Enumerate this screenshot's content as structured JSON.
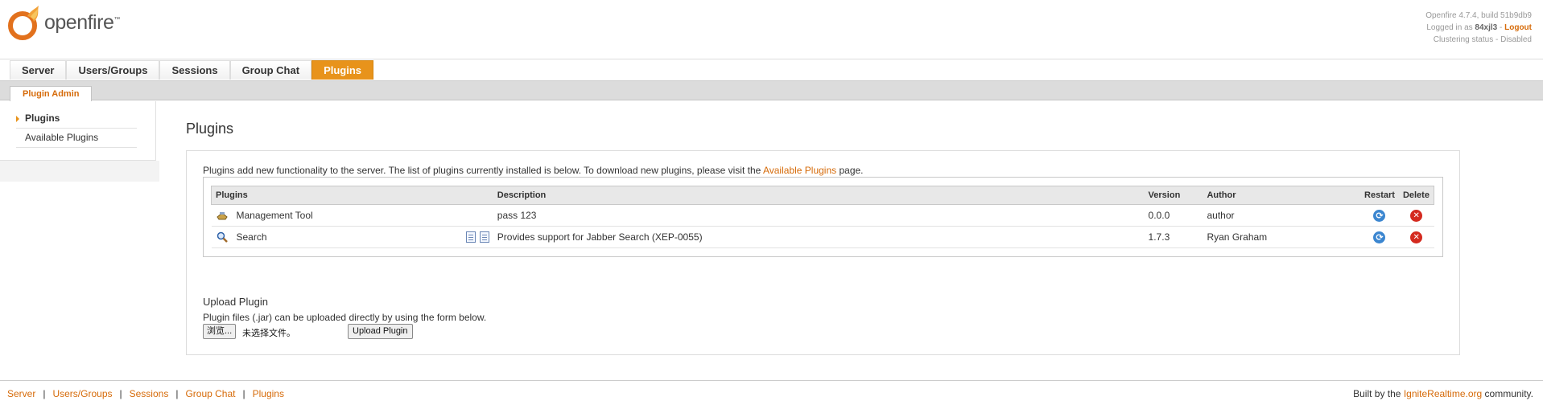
{
  "header": {
    "logo_text": "openfire",
    "logo_tm": "™",
    "version": "Openfire 4.7.4, build 51b9db9",
    "logged_in_prefix": "Logged in as ",
    "username": "84xjl3",
    "logged_in_sep": " - ",
    "logout": "Logout",
    "clustering": "Clustering status - Disabled"
  },
  "mainnav": [
    "Server",
    "Users/Groups",
    "Sessions",
    "Group Chat",
    "Plugins"
  ],
  "subnav": {
    "tab": "Plugin Admin"
  },
  "sidebar": {
    "items": [
      "Plugins",
      "Available Plugins"
    ]
  },
  "page": {
    "title": "Plugins",
    "intro_prefix": "Plugins add new functionality to the server. The list of plugins currently installed is below. To download new plugins, please visit the ",
    "intro_link": "Available Plugins",
    "intro_suffix": " page."
  },
  "table": {
    "headers": [
      "Plugins",
      "Description",
      "Version",
      "Author",
      "Restart",
      "Delete"
    ],
    "rows": [
      {
        "name": "Management Tool",
        "description": "pass 123",
        "version": "0.0.0",
        "author": "author",
        "icon": "management-tool-icon"
      },
      {
        "name": "Search",
        "description": "Provides support for Jabber Search (XEP-0055)",
        "version": "1.7.3",
        "author": "Ryan Graham",
        "icon": "search-icon"
      }
    ]
  },
  "upload": {
    "title": "Upload Plugin",
    "description": "Plugin files (.jar) can be uploaded directly by using the form below.",
    "browse": "浏览...",
    "no_file": "未选择文件。",
    "button": "Upload Plugin"
  },
  "footer": {
    "links": [
      "Server",
      "Users/Groups",
      "Sessions",
      "Group Chat",
      "Plugins"
    ],
    "separator": "|",
    "credit_prefix": "Built by the ",
    "credit_link": "IgniteRealtime.org",
    "credit_suffix": " community."
  },
  "colors": {
    "accent": "#e8931b",
    "link": "#d66b0a"
  }
}
